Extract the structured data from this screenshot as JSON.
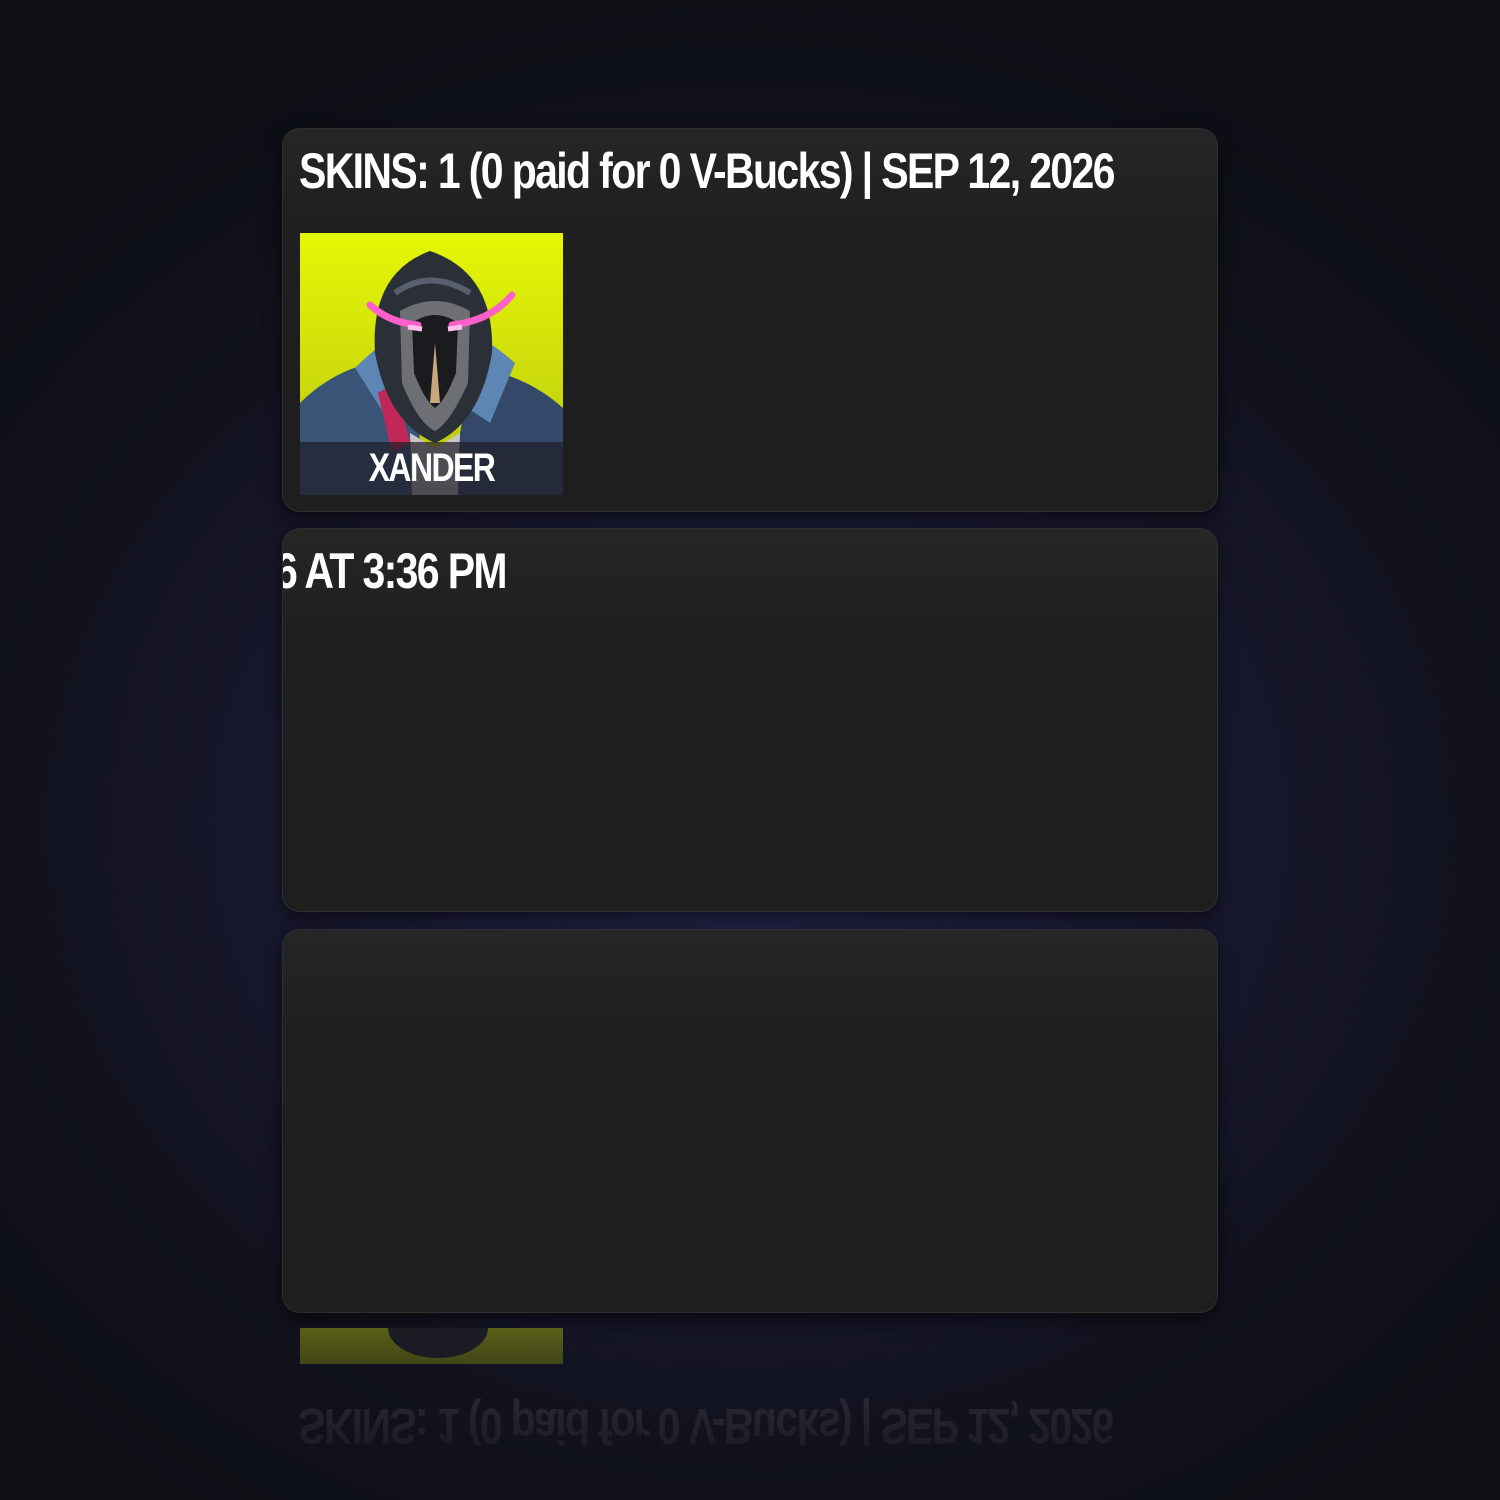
{
  "header": {
    "title_part1": "SKINS: 1 (0 paid for 0 V-Bucks) | SEP 12, 2026",
    "title_part2": "6 AT 3:36 PM"
  },
  "items": [
    {
      "name": "XANDER",
      "category": "skin",
      "background_color": "#e4f806"
    }
  ],
  "colors": {
    "panel_bg": "#1e1e1e",
    "page_bg": "#11121d",
    "tile_bg": "#e4f806",
    "text": "#ffffff"
  }
}
